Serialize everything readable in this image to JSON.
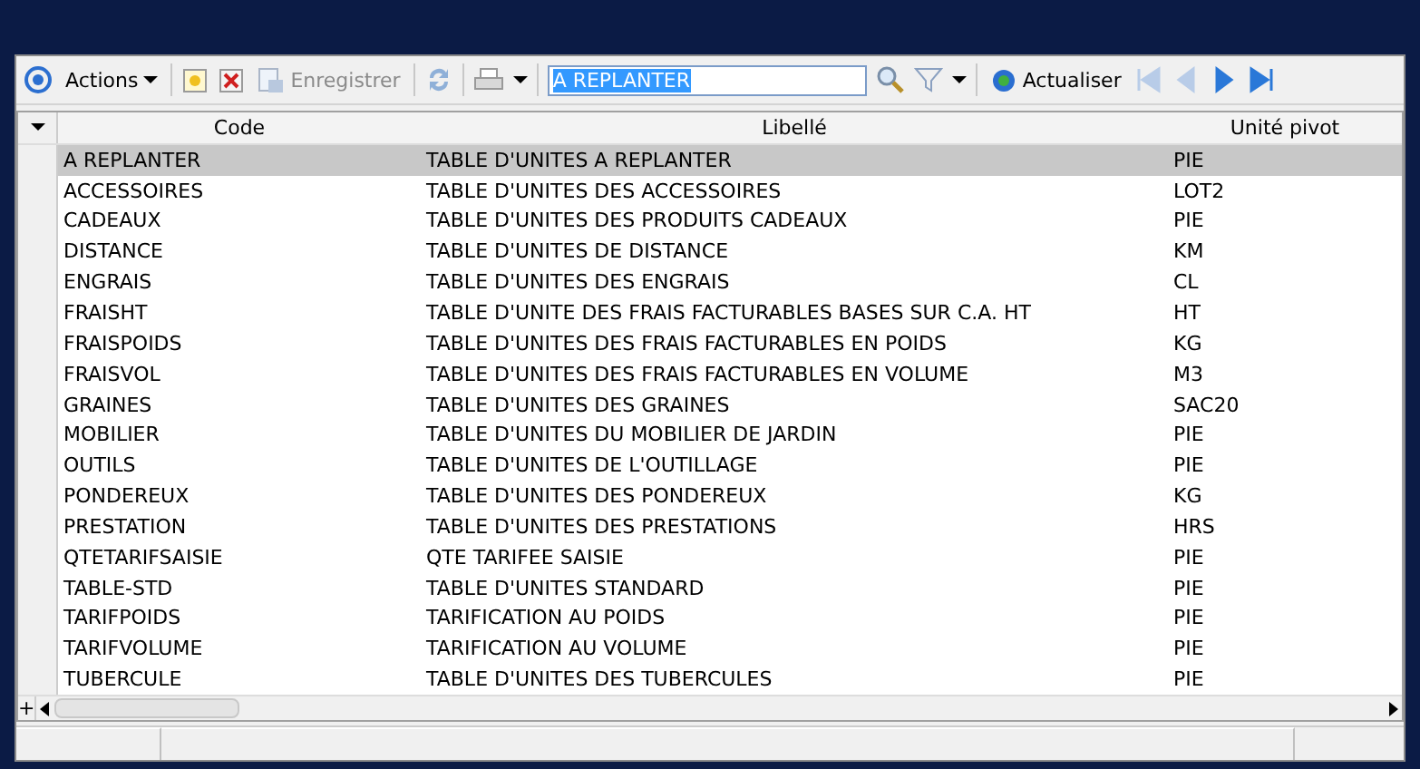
{
  "toolbar": {
    "actions_label": "Actions",
    "save": {
      "label": "Enregistrer",
      "disabled": true
    },
    "search": {
      "value": "A REPLANTER"
    },
    "refresh_label": "Actualiser",
    "nav": [
      {
        "kind": "first",
        "disabled": true
      },
      {
        "kind": "prev",
        "disabled": true
      },
      {
        "kind": "next",
        "disabled": false
      },
      {
        "kind": "last",
        "disabled": false
      }
    ]
  },
  "table": {
    "columns": [
      "Code",
      "Libellé",
      "Unité pivot"
    ],
    "rows": [
      {
        "cells": [
          "A REPLANTER",
          "TABLE D'UNITES  A REPLANTER",
          "PIE"
        ],
        "selected": true
      },
      {
        "cells": [
          "ACCESSOIRES",
          "TABLE D'UNITES DES ACCESSOIRES",
          "LOT2"
        ],
        "selected": false
      },
      {
        "cells": [
          "CADEAUX",
          "TABLE D'UNITES DES PRODUITS CADEAUX",
          "PIE"
        ],
        "selected": false
      },
      {
        "cells": [
          "DISTANCE",
          "TABLE D'UNITES DE DISTANCE",
          "KM"
        ],
        "selected": false
      },
      {
        "cells": [
          "ENGRAIS",
          "TABLE D'UNITES DES ENGRAIS",
          "CL"
        ],
        "selected": false
      },
      {
        "cells": [
          "FRAISHT",
          "TABLE D'UNITE DES FRAIS FACTURABLES BASES SUR C.A. HT",
          "HT"
        ],
        "selected": false
      },
      {
        "cells": [
          "FRAISPOIDS",
          "TABLE D'UNITES DES FRAIS FACTURABLES EN POIDS",
          "KG"
        ],
        "selected": false
      },
      {
        "cells": [
          "FRAISVOL",
          "TABLE D'UNITES DES FRAIS FACTURABLES EN VOLUME",
          "M3"
        ],
        "selected": false
      },
      {
        "cells": [
          "GRAINES",
          "TABLE D'UNITES DES GRAINES",
          "SAC20"
        ],
        "selected": false
      },
      {
        "cells": [
          "MOBILIER",
          "TABLE D'UNITES DU MOBILIER DE JARDIN",
          "PIE"
        ],
        "selected": false
      },
      {
        "cells": [
          "OUTILS",
          "TABLE D'UNITES DE L'OUTILLAGE",
          "PIE"
        ],
        "selected": false
      },
      {
        "cells": [
          "PONDEREUX",
          "TABLE D'UNITES DES PONDEREUX",
          "KG"
        ],
        "selected": false
      },
      {
        "cells": [
          "PRESTATION",
          "TABLE D'UNITES DES PRESTATIONS",
          "HRS"
        ],
        "selected": false
      },
      {
        "cells": [
          "QTETARIFSAISIE",
          "QTE TARIFEE SAISIE",
          "PIE"
        ],
        "selected": false
      },
      {
        "cells": [
          "TABLE-STD",
          "TABLE D'UNITES STANDARD",
          "PIE"
        ],
        "selected": false
      },
      {
        "cells": [
          "TARIFPOIDS",
          "TARIFICATION AU POIDS",
          "PIE"
        ],
        "selected": false
      },
      {
        "cells": [
          "TARIFVOLUME",
          "TARIFICATION AU VOLUME",
          "PIE"
        ],
        "selected": false
      },
      {
        "cells": [
          "TUBERCULE",
          "TABLE D'UNITES DES TUBERCULES",
          "PIE"
        ],
        "selected": false
      }
    ],
    "add_row_symbol": "+"
  }
}
